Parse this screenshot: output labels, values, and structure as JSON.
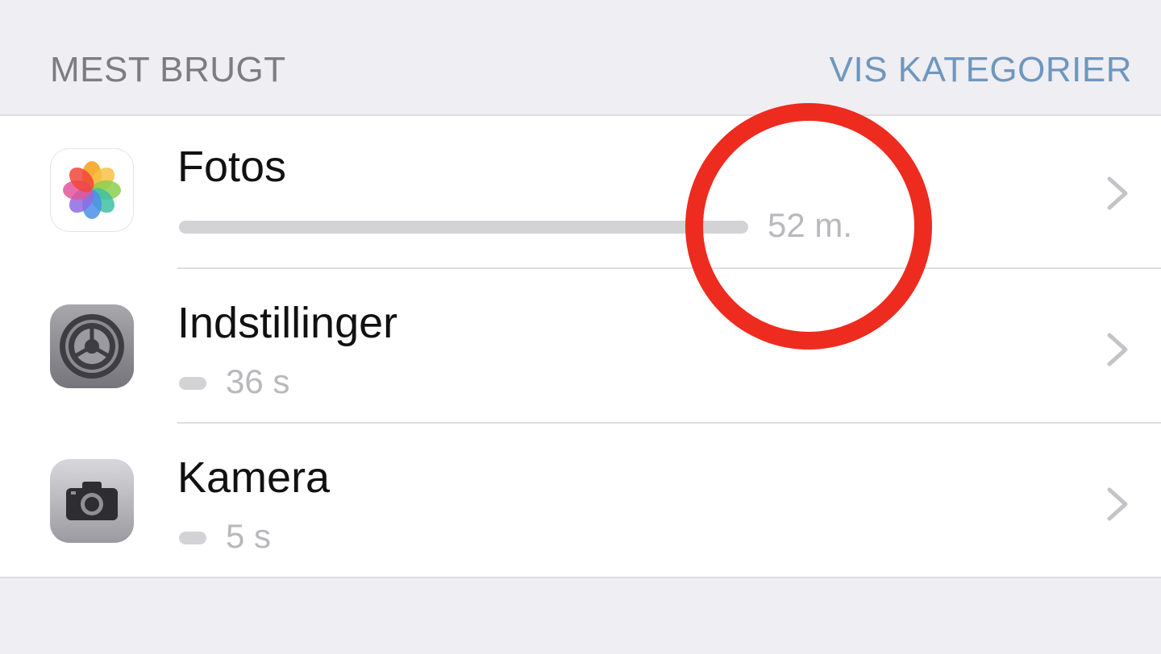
{
  "section": {
    "title": "MEST BRUGT",
    "action_label": "VIS KATEGORIER"
  },
  "apps": [
    {
      "name": "Fotos",
      "usage": "52 m.",
      "usage_fraction": 1.0,
      "icon": "photos-icon"
    },
    {
      "name": "Indstillinger",
      "usage": "36 s",
      "usage_fraction": 0.011,
      "icon": "settings-gear-icon"
    },
    {
      "name": "Kamera",
      "usage": "5 s",
      "usage_fraction": 0.002,
      "icon": "camera-icon"
    }
  ],
  "colors": {
    "background": "#eeeef3",
    "list_background": "#ffffff",
    "accent": "#6f97be",
    "header_text": "#7c7c82",
    "usage_bar": "#d3d3d6",
    "usage_text": "#b8b8bd",
    "highlight_circle": "#ee2b1f"
  }
}
